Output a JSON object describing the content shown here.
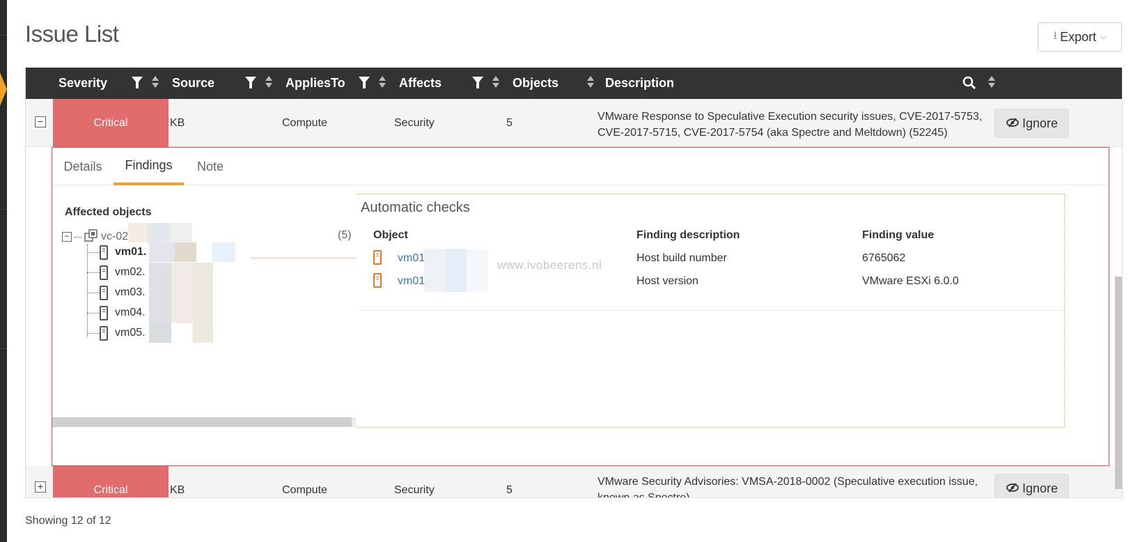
{
  "page": {
    "title": "Issue List",
    "export_label": "Export",
    "footer": "Showing 12 of 12"
  },
  "table": {
    "columns": [
      "Severity",
      "Source",
      "AppliesTo",
      "Affects",
      "Objects",
      "Description"
    ],
    "rows": [
      {
        "expander": "−",
        "severity": "Critical",
        "source": "KB",
        "applies_to": "Compute",
        "affects": "Security",
        "objects": "5",
        "description": "VMware Response to Speculative Execution security issues, CVE-2017-5753, CVE-2017-5715, CVE-2017-5754 (aka Spectre and Meltdown) (52245)",
        "ignore_label": "Ignore"
      },
      {
        "expander": "+",
        "severity": "Critical",
        "source": "KB",
        "applies_to": "Compute",
        "affects": "Security",
        "objects": "5",
        "description": "VMware Security Advisories: VMSA-2018-0002 (Speculative execution issue, known as Spectre)",
        "ignore_label": "Ignore"
      }
    ]
  },
  "detail": {
    "tabs": [
      "Details",
      "Findings",
      "Note"
    ],
    "active_tab": "Findings",
    "affected_objects_title": "Affected objects",
    "tree": {
      "root_label": "vc-02.",
      "root_count": "(5)",
      "children": [
        "vm01.",
        "vm02.",
        "vm03.",
        "vm04.",
        "vm05."
      ]
    },
    "auto_checks": {
      "title": "Automatic checks",
      "headers": [
        "Object",
        "Finding description",
        "Finding value"
      ],
      "rows": [
        {
          "object": "vm01",
          "description": "Host build number",
          "value": "6765062"
        },
        {
          "object": "vm01",
          "description": "Host version",
          "value": "VMware ESXi 6.0.0"
        }
      ],
      "watermark": "www.ivobeerens.nl"
    }
  },
  "colors": {
    "header_bg": "#333333",
    "critical": "#e06c6c",
    "accent_orange": "#f0a030",
    "link_blue": "#337ab7",
    "expanded_border": "#d9534f"
  }
}
